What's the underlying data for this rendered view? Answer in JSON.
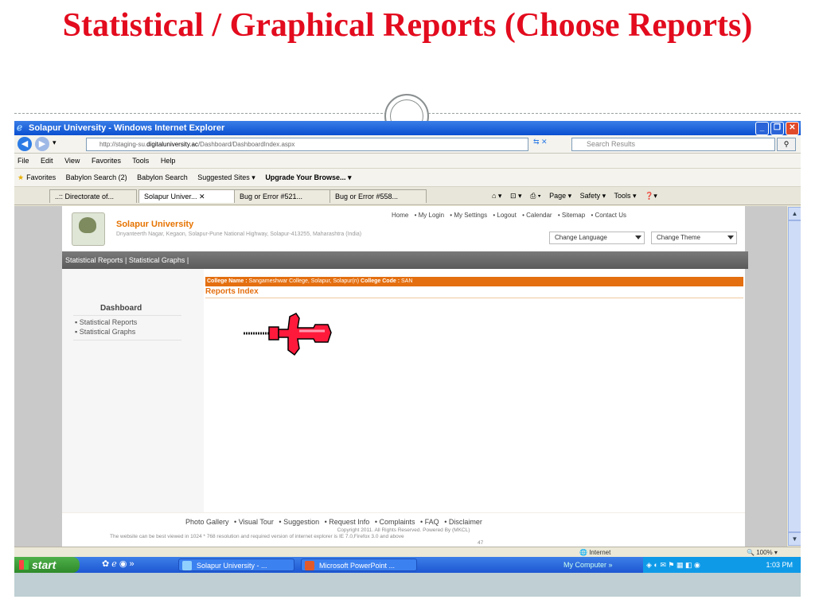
{
  "slide": {
    "title": "Statistical / Graphical Reports (Choose Reports)"
  },
  "window": {
    "title": "Solapur University - Windows Internet Explorer",
    "buttons": {
      "minimize": "_",
      "maximize": "❐",
      "close": "✕"
    }
  },
  "address_bar": {
    "url_prefix": "http://staging-su.",
    "url_domain": "digitaluniversity.ac",
    "url_path": "/Dashboard/DashboardIndex.aspx",
    "search_placeholder": "Search Results"
  },
  "menu": [
    "File",
    "Edit",
    "View",
    "Favorites",
    "Tools",
    "Help"
  ],
  "favorites_bar": {
    "favorites": "Favorites",
    "items": [
      "Babylon Search (2)",
      "Babylon Search",
      "Suggested Sites ▾",
      "Upgrade Your Browse... ▾"
    ]
  },
  "tabs": [
    {
      "label": "..:: Directorate of..."
    },
    {
      "label": "Solapur Univer... ✕"
    },
    {
      "label": "Bug or Error #521..."
    },
    {
      "label": "Bug or Error #558..."
    }
  ],
  "tab_tools": [
    "Page ▾",
    "Safety ▾",
    "Tools ▾"
  ],
  "site": {
    "name": "Solapur University",
    "address": "Dnyanteerth Nagar, Kegaon, Solapur-Pune National Highway, Solapur-413255, Maharashtra (India)",
    "top_links": [
      "Home",
      "• My Login",
      "• My Settings",
      "• Logout",
      "• Calendar",
      "• Sitemap",
      "• Contact Us"
    ],
    "change_language": "Change Language",
    "change_theme": "Change Theme",
    "nav_bar": "Statistical Reports | Statistical Graphs |"
  },
  "sidebar": {
    "title": "Dashboard",
    "items": [
      "Statistical Reports",
      "Statistical Graphs"
    ]
  },
  "content": {
    "college_label": "College Name :",
    "college_value": "Sangameshwar College, Solapur, Solapur(n)",
    "code_label": "College Code :",
    "code_value": "SAN",
    "reports_title": "Reports Index"
  },
  "footer": {
    "links": [
      "Photo Gallery",
      "• Visual Tour",
      "• Suggestion",
      "• Request Info",
      "• Complaints",
      "• FAQ",
      "• Disclaimer"
    ],
    "copyright": "Copyright 2011. All Rights Reserved. Powered By (MKCL)",
    "best_view": "The website can be best viewed in 1024 * 768 resolution and required version of internet explorer is IE 7.0,Firefox 3.0 and above",
    "counter": "47"
  },
  "status_bar": {
    "zone": "Internet",
    "zoom": "100%"
  },
  "taskbar": {
    "start": "start",
    "tasks": [
      "Solapur University - ...",
      "Microsoft PowerPoint ..."
    ],
    "my_computer": "My Computer",
    "clock": "1:03 PM"
  },
  "colors": {
    "title_red": "#e30b1e",
    "accent_orange": "#e46f10",
    "xp_blue": "#0a4fd0"
  }
}
